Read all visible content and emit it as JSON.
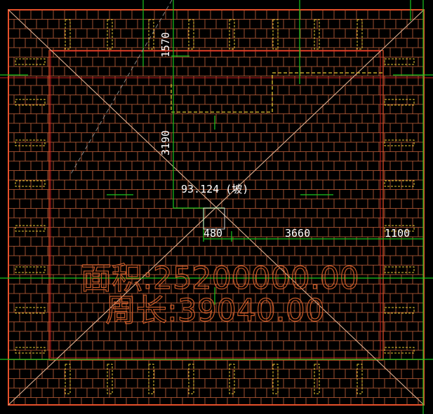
{
  "colors": {
    "background": "#000000",
    "tile": "#c8643c",
    "outline": "#e8502a",
    "ridge": "#e0b090",
    "green": "#19c81e",
    "yellow": "#e8c832",
    "red": "#d02020",
    "text": "#ffffff",
    "summary": "#c85a28"
  },
  "dimensions": {
    "top_vertical": "1570",
    "left_vertical": "3190",
    "center_label": "93.124 (坡)",
    "bottom_left": "480",
    "bottom_mid": "3660",
    "bottom_right": "1100"
  },
  "summary": {
    "area_line": "面积:25200000.00",
    "perimeter_line": "周长:39040.00"
  }
}
